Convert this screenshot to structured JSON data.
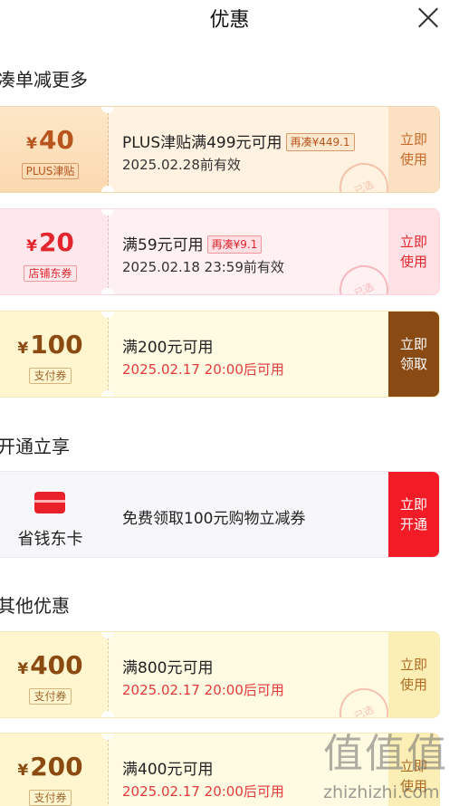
{
  "header": {
    "title": "优惠"
  },
  "sections": {
    "bundle": "凑单减更多",
    "vip": "开通立享",
    "other": "其他优惠"
  },
  "coupons": [
    {
      "amount": "40",
      "badge": "PLUS津贴",
      "main": "PLUS津贴满499元可用",
      "tag": "再凑¥449.1",
      "sub": "2025.02.28前有效",
      "action": "立即使用",
      "stamp": "已选"
    },
    {
      "amount": "20",
      "badge": "店铺东券",
      "main": "满59元可用",
      "tag": "再凑¥9.1",
      "sub": "2025.02.18 23:59前有效",
      "action": "立即使用",
      "stamp": "已选"
    },
    {
      "amount": "100",
      "badge": "支付券",
      "main": "满200元可用",
      "sub": "2025.02.17 20:00后可用",
      "action": "立即领取"
    }
  ],
  "vip": {
    "name": "省钱东卡",
    "text": "免费领取100元购物立减券",
    "action": "立即开通"
  },
  "other_coupons": [
    {
      "amount": "400",
      "badge": "支付券",
      "main": "满800元可用",
      "sub": "2025.02.17 20:00后可用",
      "action": "立即使用",
      "stamp": "已选"
    },
    {
      "amount": "200",
      "badge": "支付券",
      "main": "满400元可用",
      "sub": "2025.02.17 20:00后可用",
      "action": "立即使用"
    }
  ],
  "currency_symbol": "¥",
  "watermark": {
    "logo": "值值值",
    "text": "zhizhizhi.com"
  },
  "colors": {
    "vip_red": "#f21b26",
    "claim_brown": "#8a4a14",
    "date_red": "#e33b3b"
  }
}
